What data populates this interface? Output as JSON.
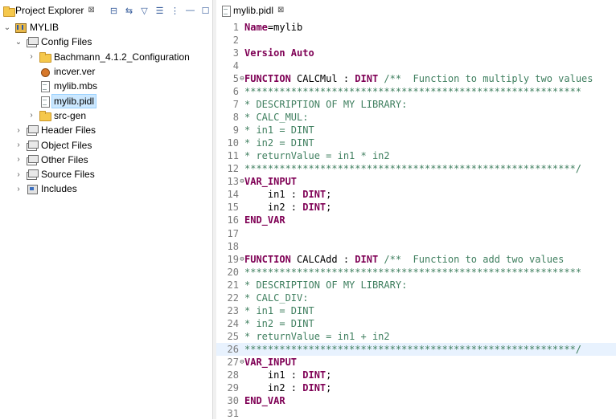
{
  "explorer": {
    "tab_label": "Project Explorer",
    "tab_close": "⊠",
    "toolbar": [
      {
        "name": "collapse-all-icon",
        "glyph": "⊟"
      },
      {
        "name": "link-editor-icon",
        "glyph": "⇆"
      },
      {
        "name": "filter-icon",
        "glyph": "▽"
      },
      {
        "name": "focus-icon",
        "glyph": "☰"
      },
      {
        "name": "view-menu-icon",
        "glyph": "⋮"
      },
      {
        "name": "minimize-icon",
        "glyph": "—"
      },
      {
        "name": "maximize-icon",
        "glyph": "☐"
      }
    ],
    "tree": {
      "root": "MYLIB",
      "config_files": "Config Files",
      "bachmann": "Bachmann_4.1.2_Configuration",
      "incver": "incver.ver",
      "mylib_mbs": "mylib.mbs",
      "mylib_pidl": "mylib.pidl",
      "src_gen": "src-gen",
      "header_files": "Header Files",
      "object_files": "Object Files",
      "other_files": "Other Files",
      "source_files": "Source Files",
      "includes": "Includes"
    }
  },
  "editor": {
    "tab_label": "mylib.pidl",
    "tab_close": "⊠",
    "lines": [
      {
        "n": "1",
        "t": [
          [
            "kw",
            "Name"
          ],
          [
            "",
            "=mylib"
          ]
        ]
      },
      {
        "n": "2",
        "t": []
      },
      {
        "n": "3",
        "t": [
          [
            "kw",
            "Version Auto"
          ]
        ]
      },
      {
        "n": "4",
        "t": []
      },
      {
        "n": "5",
        "fold": true,
        "t": [
          [
            "kw",
            "FUNCTION"
          ],
          [
            "",
            " CALCMul : "
          ],
          [
            "kw",
            "DINT"
          ],
          [
            "",
            " "
          ],
          [
            "cm",
            "/**  Function to multiply two values"
          ]
        ]
      },
      {
        "n": "6",
        "t": [
          [
            "cm",
            "**********************************************************"
          ]
        ]
      },
      {
        "n": "7",
        "t": [
          [
            "cm",
            "* DESCRIPTION OF MY LIBRARY:"
          ]
        ]
      },
      {
        "n": "8",
        "t": [
          [
            "cm",
            "* CALC_MUL:"
          ]
        ]
      },
      {
        "n": "9",
        "t": [
          [
            "cm",
            "* in1 = DINT"
          ]
        ]
      },
      {
        "n": "10",
        "t": [
          [
            "cm",
            "* in2 = DINT"
          ]
        ]
      },
      {
        "n": "11",
        "t": [
          [
            "cm",
            "* returnValue = in1 * in2"
          ]
        ]
      },
      {
        "n": "12",
        "t": [
          [
            "cm",
            "*********************************************************/"
          ]
        ]
      },
      {
        "n": "13",
        "fold": true,
        "t": [
          [
            "kw",
            "VAR_INPUT"
          ]
        ]
      },
      {
        "n": "14",
        "t": [
          [
            "",
            "    in1 : "
          ],
          [
            "kw",
            "DINT"
          ],
          [
            "",
            ";"
          ]
        ]
      },
      {
        "n": "15",
        "t": [
          [
            "",
            "    in2 : "
          ],
          [
            "kw",
            "DINT"
          ],
          [
            "",
            ";"
          ]
        ]
      },
      {
        "n": "16",
        "t": [
          [
            "kw",
            "END_VAR"
          ]
        ]
      },
      {
        "n": "17",
        "t": []
      },
      {
        "n": "18",
        "t": []
      },
      {
        "n": "19",
        "fold": true,
        "t": [
          [
            "kw",
            "FUNCTION"
          ],
          [
            "",
            " CALCAdd : "
          ],
          [
            "kw",
            "DINT"
          ],
          [
            "",
            " "
          ],
          [
            "cm",
            "/**  Function to add two values"
          ]
        ]
      },
      {
        "n": "20",
        "t": [
          [
            "cm",
            "**********************************************************"
          ]
        ]
      },
      {
        "n": "21",
        "t": [
          [
            "cm",
            "* DESCRIPTION OF MY LIBRARY:"
          ]
        ]
      },
      {
        "n": "22",
        "t": [
          [
            "cm",
            "* CALC_DIV:"
          ]
        ]
      },
      {
        "n": "23",
        "t": [
          [
            "cm",
            "* in1 = DINT"
          ]
        ]
      },
      {
        "n": "24",
        "t": [
          [
            "cm",
            "* in2 = DINT"
          ]
        ]
      },
      {
        "n": "25",
        "t": [
          [
            "cm",
            "* returnValue = in1 + in2"
          ]
        ]
      },
      {
        "n": "26",
        "current": true,
        "t": [
          [
            "cm",
            "*********************************************************/"
          ]
        ]
      },
      {
        "n": "27",
        "fold": true,
        "t": [
          [
            "kw",
            "VAR_INPUT"
          ]
        ]
      },
      {
        "n": "28",
        "t": [
          [
            "",
            "    in1 : "
          ],
          [
            "kw",
            "DINT"
          ],
          [
            "",
            ";"
          ]
        ]
      },
      {
        "n": "29",
        "t": [
          [
            "",
            "    in2 : "
          ],
          [
            "kw",
            "DINT"
          ],
          [
            "",
            ";"
          ]
        ]
      },
      {
        "n": "30",
        "t": [
          [
            "kw",
            "END_VAR"
          ]
        ]
      },
      {
        "n": "31",
        "t": []
      }
    ]
  }
}
